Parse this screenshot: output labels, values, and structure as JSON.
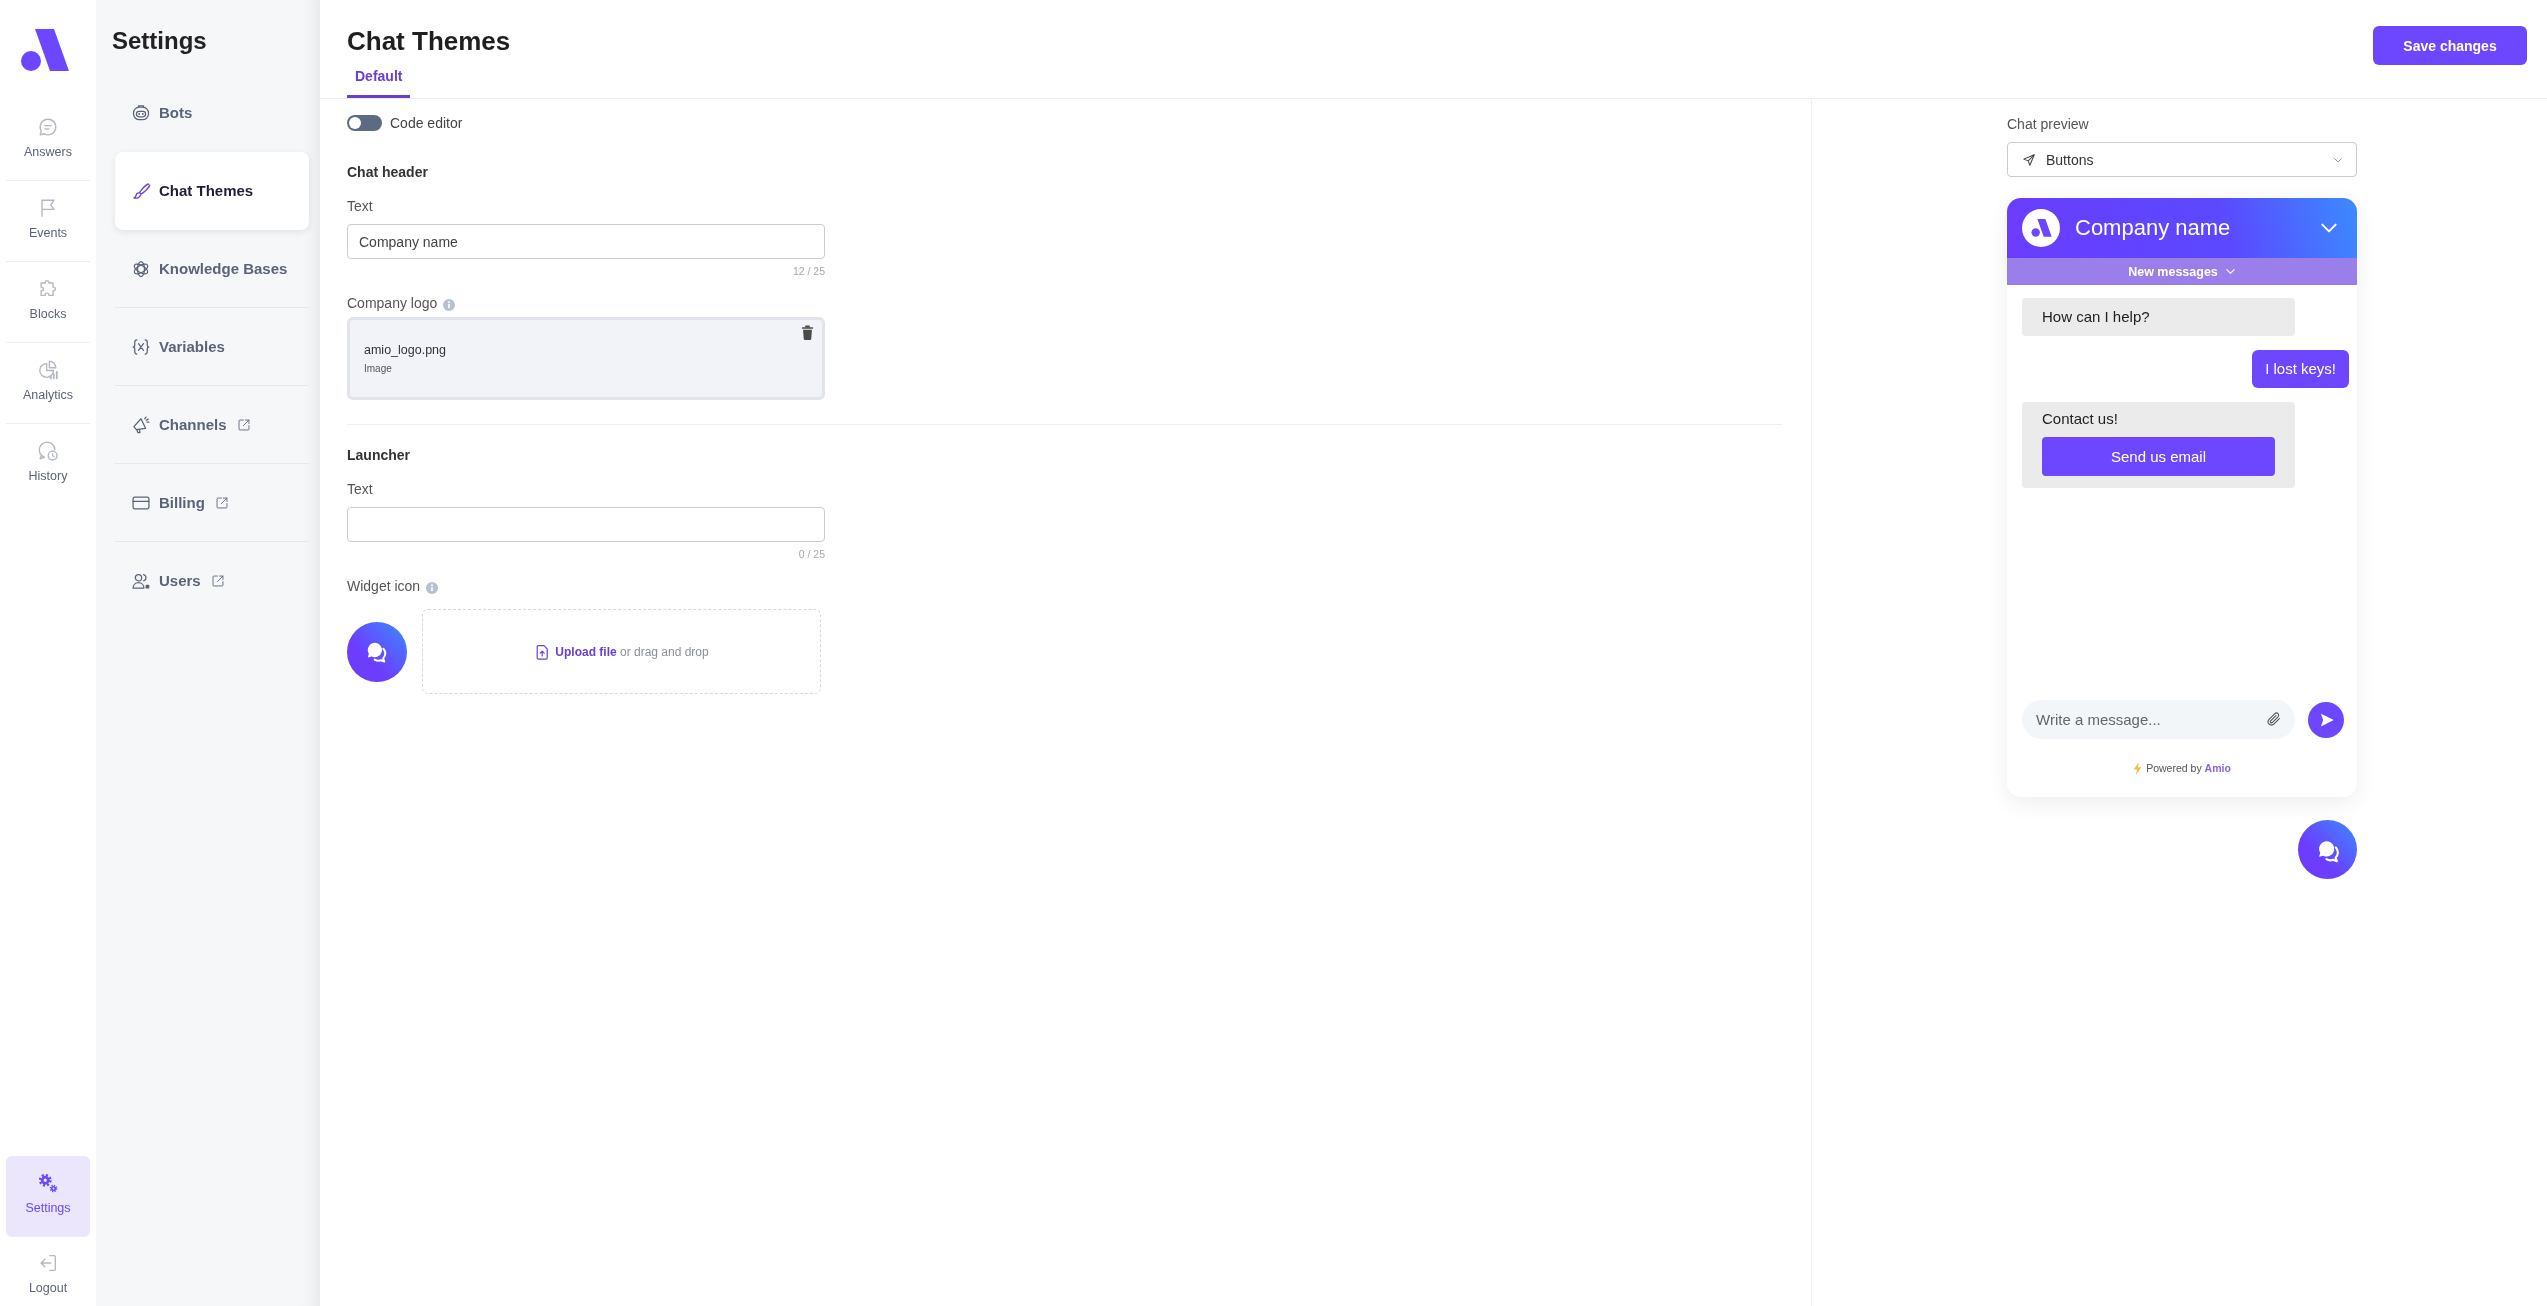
{
  "nav_rail": {
    "items": [
      {
        "label": "Answers",
        "selected": false
      },
      {
        "label": "Events",
        "selected": false
      },
      {
        "label": "Blocks",
        "selected": false
      },
      {
        "label": "Analytics",
        "selected": false
      },
      {
        "label": "History",
        "selected": false
      }
    ],
    "bottom_items": [
      {
        "label": "Settings",
        "selected": true
      },
      {
        "label": "Logout",
        "selected": false
      }
    ]
  },
  "settings_nav": {
    "title": "Settings",
    "items": [
      {
        "label": "Bots",
        "selected": false,
        "external": false
      },
      {
        "label": "Chat Themes",
        "selected": true,
        "external": false
      },
      {
        "label": "Knowledge Bases",
        "selected": false,
        "external": false
      },
      {
        "label": "Variables",
        "selected": false,
        "external": false
      },
      {
        "label": "Channels",
        "selected": false,
        "external": true
      },
      {
        "label": "Billing",
        "selected": false,
        "external": true
      },
      {
        "label": "Users",
        "selected": false,
        "external": true
      }
    ]
  },
  "page": {
    "title": "Chat Themes",
    "tabs": [
      {
        "label": "Default",
        "selected": true
      }
    ],
    "save_button": "Save changes"
  },
  "form": {
    "code_editor": {
      "label": "Code editor",
      "on": false
    },
    "sections": [
      {
        "title": "Chat header",
        "fields": [
          {
            "kind": "text",
            "label": "Text",
            "info": false,
            "value": "Company name",
            "counter": "12 / 25"
          },
          {
            "kind": "file",
            "label": "Company logo",
            "info": true,
            "file_name": "amio_logo.png",
            "file_type": "Image"
          }
        ]
      },
      {
        "title": "Launcher",
        "fields": [
          {
            "kind": "text",
            "label": "Text",
            "info": false,
            "counter": "0 / 25"
          },
          {
            "kind": "icon_upload",
            "label": "Widget icon",
            "info": true,
            "upload_link": "Upload file",
            "upload_hint": "or drag and drop"
          }
        ]
      }
    ]
  },
  "preview": {
    "label": "Chat preview",
    "select": {
      "value": "Buttons"
    },
    "widget": {
      "title": "Company name",
      "new_messages": "New messages",
      "messages": [
        {
          "kind": "bot",
          "text": "How can I help?"
        },
        {
          "kind": "user",
          "text": "I lost keys!"
        },
        {
          "kind": "bot",
          "text": "Contact us!",
          "buttons": [
            "Send us email"
          ]
        }
      ],
      "composer": {
        "placeholder": "Write a message..."
      },
      "powered_by": {
        "text": "Powered by",
        "brand": "Amio"
      }
    }
  }
}
